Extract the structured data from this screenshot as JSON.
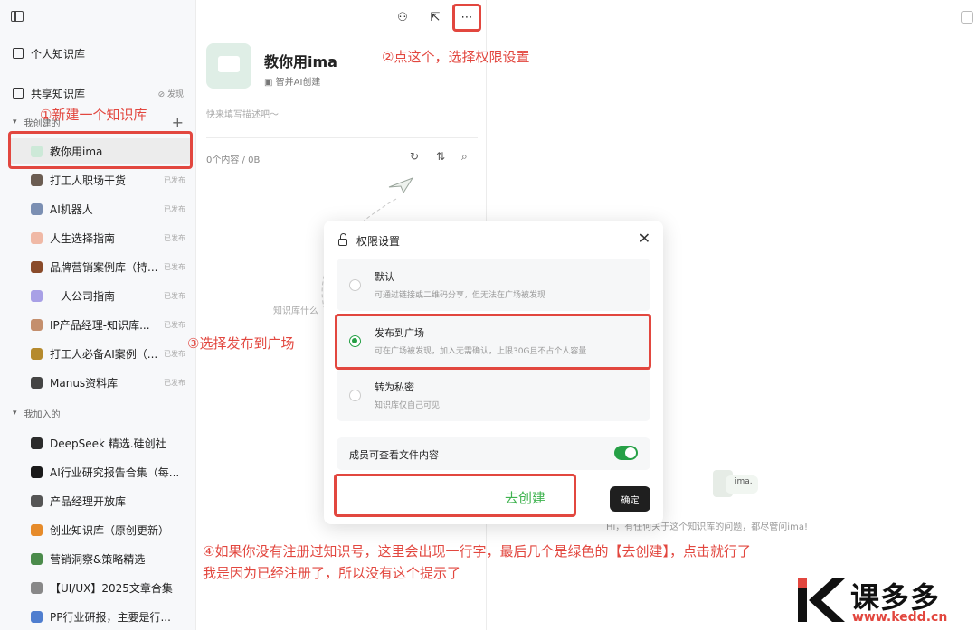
{
  "sidebar": {
    "personal_label": "个人知识库",
    "shared_label": "共享知识库",
    "discover_label": "发现",
    "created_group_label": "我创建的",
    "joined_group_label": "我加入的",
    "created_items": [
      {
        "name": "教你用ima",
        "status": "",
        "color": "#cde9d8"
      },
      {
        "name": "打工人职场干货",
        "status": "已发布",
        "color": "#6b5d52"
      },
      {
        "name": "AI机器人",
        "status": "已发布",
        "color": "#7b8fb2"
      },
      {
        "name": "人生选择指南",
        "status": "已发布",
        "color": "#f0b9a6"
      },
      {
        "name": "品牌营销案例库（持...",
        "status": "已发布",
        "color": "#8a4b2a"
      },
      {
        "name": "一人公司指南",
        "status": "已发布",
        "color": "#a8a0e6"
      },
      {
        "name": "IP产品经理-知识库...",
        "status": "已发布",
        "color": "#c48f6d"
      },
      {
        "name": "打工人必备AI案例（...",
        "status": "已发布",
        "color": "#b58a2d"
      },
      {
        "name": "Manus资料库",
        "status": "已发布",
        "color": "#444444"
      }
    ],
    "joined_items": [
      {
        "name": "DeepSeek 精选.硅创社",
        "color": "#2b2b2b"
      },
      {
        "name": "AI行业研究报告合集（每...",
        "color": "#1a1a1a"
      },
      {
        "name": "产品经理开放库",
        "color": "#555555"
      },
      {
        "name": "创业知识库（原创更新）",
        "color": "#e68b2a"
      },
      {
        "name": "营销洞察&策略精选",
        "color": "#4b8b4b"
      },
      {
        "name": "【UI/UX】2025文章合集",
        "color": "#888888"
      },
      {
        "name": "PP行业研报，主要是行...",
        "color": "#4f7ecf"
      }
    ]
  },
  "middle": {
    "kb_title": "教你用ima",
    "kb_author": "智并AI创建",
    "kb_desc_placeholder": "快来填写描述吧～",
    "content_count": "0个内容 / 0B",
    "empty_hint": "知识库什么"
  },
  "right": {
    "chat_hint": "Hi，有任何关于这个知识库的问题，都尽管问ima!",
    "bubble_text": "ima."
  },
  "modal": {
    "title": "权限设置",
    "options": [
      {
        "title": "默认",
        "desc": "可通过链接或二维码分享，但无法在广场被发现",
        "selected": false
      },
      {
        "title": "发布到广场",
        "desc": "可在广场被发现，加入无需确认，上限30G且不占个人容量",
        "selected": true
      },
      {
        "title": "转为私密",
        "desc": "知识库仅自己可见",
        "selected": false
      }
    ],
    "toggle_label": "成员可查看文件内容",
    "toggle_on": true,
    "create_link": "去创建",
    "confirm_label": "确定"
  },
  "annotations": {
    "step1": "①新建一个知识库",
    "step2": "②点这个，选择权限设置",
    "step3": "③选择发布到广场",
    "step4_line1": "④如果你没有注册过知识号，这里会出现一行字，最后几个是绿色的【去创建】，点击就行了",
    "step4_line2": "我是因为已经注册了，所以没有这个提示了"
  },
  "watermark": {
    "brand": "课多多",
    "url": "www.kedd.cn",
    "accent": "#e2473f"
  }
}
